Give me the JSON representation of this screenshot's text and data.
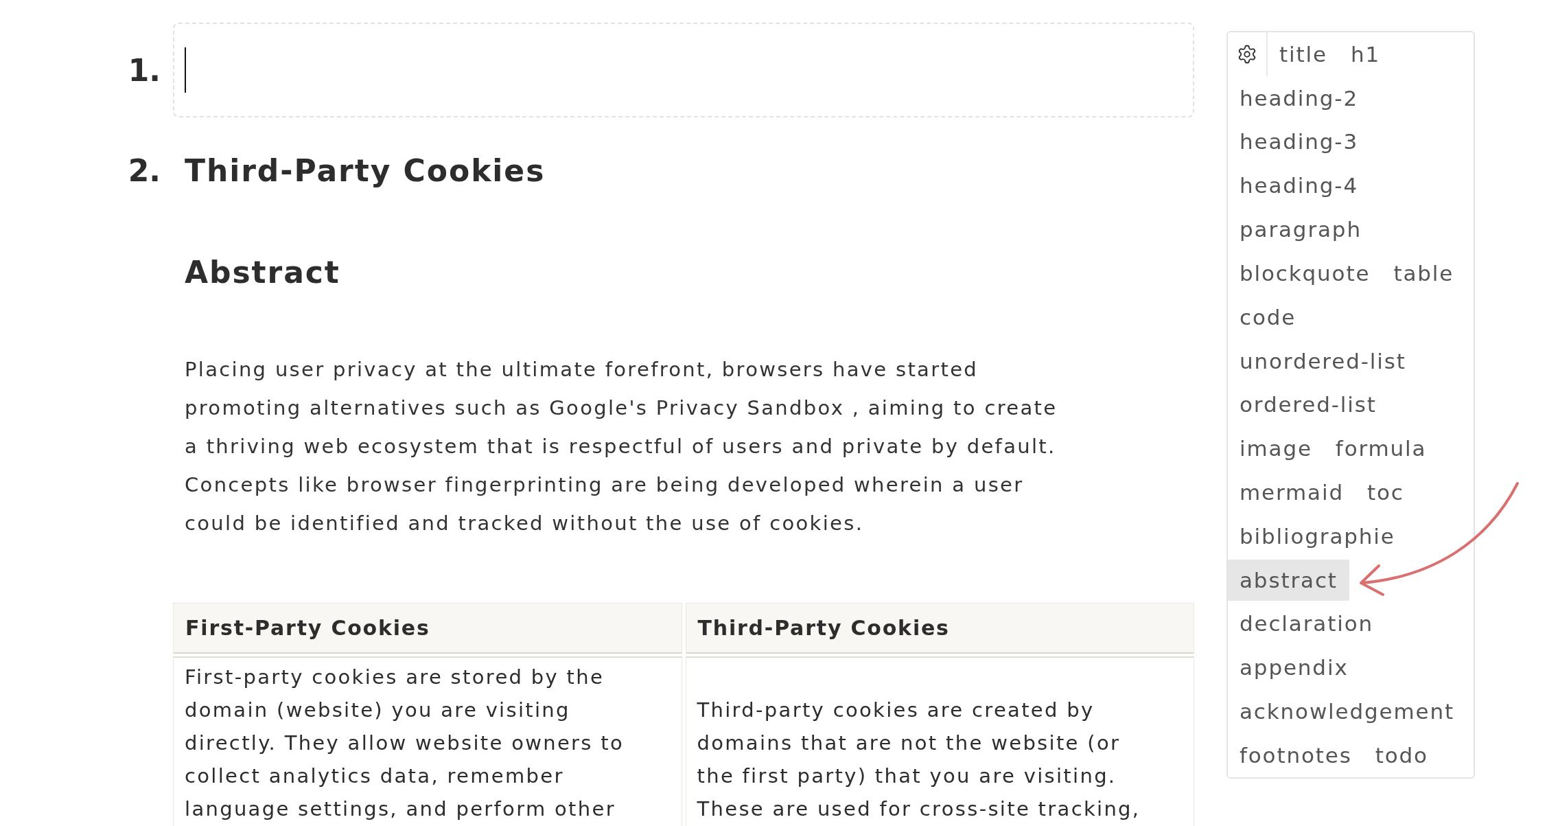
{
  "outline": [
    {
      "kind": "empty_block",
      "marker": "1.",
      "focused": true
    },
    {
      "kind": "heading",
      "marker": "2.",
      "text": "Third-Party Cookies"
    }
  ],
  "section": {
    "heading": "Abstract",
    "paragraph": "Placing user privacy at the ultimate forefront, browsers have started promoting alternatives such as Google's Privacy Sandbox , aiming to create a thriving web ecosystem that is respectful of users and private by default. Concepts like browser fingerprinting are being developed wherein a user could be identified and tracked without the use of cookies."
  },
  "table": {
    "columns": [
      "First-Party Cookies",
      "Third-Party Cookies"
    ],
    "rows": [
      [
        "First-party cookies are stored by the domain (website) you are visiting directly. They allow website owners to collect analytics data, remember language settings, and perform other",
        "Third-party cookies are created by domains that are not the website (or the first party) that you are visiting. These are used for cross-site tracking,"
      ]
    ]
  },
  "block_menu": {
    "rows": [
      [
        {
          "label": "title",
          "selected": false
        },
        {
          "label": "h1",
          "selected": false
        }
      ],
      [
        {
          "label": "heading-2",
          "selected": false
        }
      ],
      [
        {
          "label": "heading-3",
          "selected": false
        }
      ],
      [
        {
          "label": "heading-4",
          "selected": false
        }
      ],
      [
        {
          "label": "paragraph",
          "selected": false
        }
      ],
      [
        {
          "label": "blockquote",
          "selected": false
        },
        {
          "label": "table",
          "selected": false
        }
      ],
      [
        {
          "label": "code",
          "selected": false
        }
      ],
      [
        {
          "label": "unordered-list",
          "selected": false
        }
      ],
      [
        {
          "label": "ordered-list",
          "selected": false
        }
      ],
      [
        {
          "label": "image",
          "selected": false
        },
        {
          "label": "formula",
          "selected": false
        }
      ],
      [
        {
          "label": "mermaid",
          "selected": false
        },
        {
          "label": "toc",
          "selected": false
        }
      ],
      [
        {
          "label": "bibliographie",
          "selected": false
        }
      ],
      [
        {
          "label": "abstract",
          "selected": true
        }
      ],
      [
        {
          "label": "declaration",
          "selected": false
        }
      ],
      [
        {
          "label": "appendix",
          "selected": false
        }
      ],
      [
        {
          "label": "acknowledgement",
          "selected": false
        }
      ],
      [
        {
          "label": "footnotes",
          "selected": false
        },
        {
          "label": "todo",
          "selected": false
        }
      ]
    ]
  }
}
